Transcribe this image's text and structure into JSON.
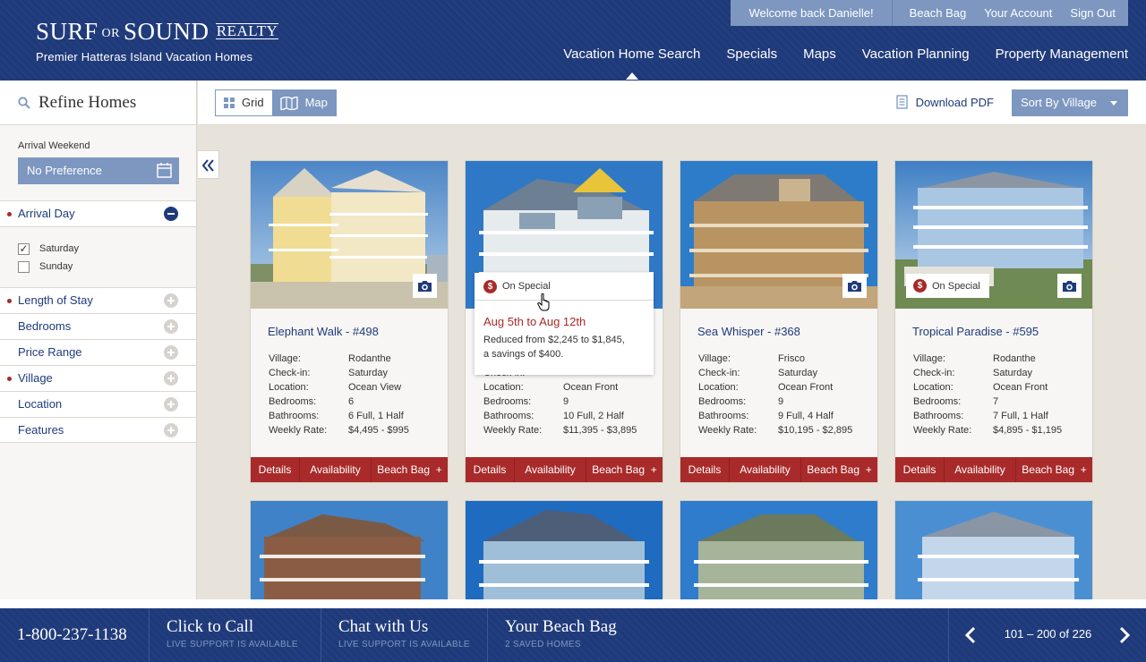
{
  "header": {
    "logo": {
      "surf": "SURF",
      "or": "OR",
      "sound": "SOUND",
      "realty": "REALTY",
      "tagline": "Premier Hatteras Island Vacation Homes"
    },
    "account": {
      "welcome": "Welcome back Danielle!",
      "beach_bag": "Beach Bag",
      "your_account": "Your Account",
      "sign_out": "Sign Out"
    },
    "nav": [
      {
        "label": "Vacation Home Search",
        "active": true
      },
      {
        "label": "Specials"
      },
      {
        "label": "Maps"
      },
      {
        "label": "Vacation Planning"
      },
      {
        "label": "Property Management"
      }
    ]
  },
  "sidebar": {
    "title": "Refine Homes",
    "arrival_weekend_label": "Arrival Weekend",
    "arrival_weekend_value": "No Preference",
    "filters": [
      {
        "label": "Arrival Day",
        "active": true,
        "expanded": true
      },
      {
        "label": "Length of Stay",
        "active": true
      },
      {
        "label": "Bedrooms"
      },
      {
        "label": "Price Range"
      },
      {
        "label": "Village",
        "active": true
      },
      {
        "label": "Location"
      },
      {
        "label": "Features"
      }
    ],
    "arrival_days": [
      {
        "label": "Saturday",
        "checked": true
      },
      {
        "label": "Sunday",
        "checked": false
      }
    ]
  },
  "toolbar": {
    "grid_label": "Grid",
    "map_label": "Map",
    "download_label": "Download PDF",
    "sort_label": "Sort By Village"
  },
  "card_labels": {
    "village": "Village:",
    "checkin": "Check-in:",
    "location": "Location:",
    "bedrooms": "Bedrooms:",
    "bathrooms": "Bathrooms:",
    "weekly_rate": "Weekly Rate:",
    "details": "Details",
    "availability": "Availability",
    "beach_bag": "Beach Bag",
    "on_special": "On Special"
  },
  "listings": [
    {
      "name": "Elephant Walk - #498",
      "village": "Rodanthe",
      "checkin": "Saturday",
      "location": "Ocean View",
      "bedrooms": "6",
      "bathrooms": "6 Full, 1 Half",
      "rate": "$4,495 - $995",
      "on_special": false
    },
    {
      "name": "",
      "village": "",
      "checkin": "",
      "location": "Ocean Front",
      "bedrooms": "9",
      "bathrooms": "10 Full, 2 Half",
      "rate": "$11,395 - $3,895",
      "on_special": true
    },
    {
      "name": "Sea Whisper - #368",
      "village": "Frisco",
      "checkin": "Saturday",
      "location": "Ocean Front",
      "bedrooms": "9",
      "bathrooms": "9 Full, 4 Half",
      "rate": "$10,195 - $2,895",
      "on_special": false
    },
    {
      "name": "Tropical Paradise - #595",
      "village": "Rodanthe",
      "checkin": "Saturday",
      "location": "Ocean Front",
      "bedrooms": "7",
      "bathrooms": "7 Full, 1 Half",
      "rate": "$4,895 - $1,195",
      "on_special": true
    }
  ],
  "tooltip": {
    "label": "On Special",
    "dates": "Aug 5th to Aug 12th",
    "desc_line1": "Reduced from $2,245 to $1,845,",
    "desc_line2": "a savings of $400."
  },
  "footer": {
    "phone": "1-800-237-1138",
    "call_title": "Click to Call",
    "call_sub": "LIVE SUPPORT IS AVAILABLE",
    "chat_title": "Chat with Us",
    "chat_sub": "LIVE SUPPORT IS AVAILABLE",
    "bag_title": "Your Beach Bag",
    "bag_sub": "2 SAVED HOMES",
    "page_count": "101 – 200 of 226"
  },
  "colors": {
    "navy": "#1f3a7a",
    "steel_blue": "#7d97c0",
    "brick_red": "#a82a2a",
    "paper": "#e8e3da"
  }
}
